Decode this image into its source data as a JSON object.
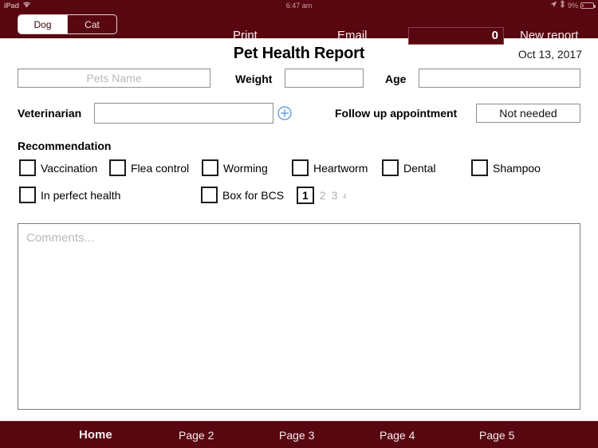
{
  "statusbar": {
    "device": "iPad",
    "wifi_icon": "wifi-icon",
    "time": "6:47 am",
    "location_icon": "location-arrow-icon",
    "bluetooth_icon": "bluetooth-icon",
    "battery_percent": "9%",
    "battery_level": 9
  },
  "toolbar": {
    "segments": [
      {
        "label": "Dog",
        "selected": true
      },
      {
        "label": "Cat",
        "selected": false
      }
    ],
    "print_label": "Print",
    "email_label": "Email",
    "counter_value": "0",
    "new_report_label": "New report"
  },
  "header": {
    "title": "Pet Health Report",
    "date": "Oct 13, 2017"
  },
  "form": {
    "pet_name": {
      "value": "",
      "placeholder": "Pets Name"
    },
    "weight": {
      "label": "Weight",
      "value": ""
    },
    "age": {
      "label": "Age",
      "value": ""
    },
    "veterinarian": {
      "label": "Veterinarian",
      "value": ""
    },
    "add_vet_icon": "circle-plus-icon",
    "follow_up": {
      "label": "Follow up appointment",
      "value": "Not needed"
    }
  },
  "recommendation": {
    "heading": "Recommendation",
    "checkboxes": [
      {
        "label": "Vaccination",
        "checked": false
      },
      {
        "label": "Flea control",
        "checked": false
      },
      {
        "label": "Worming",
        "checked": false
      },
      {
        "label": "Heartworm",
        "checked": false
      },
      {
        "label": "Dental",
        "checked": false
      },
      {
        "label": "Shampoo",
        "checked": false
      },
      {
        "label": "In perfect health",
        "checked": false
      },
      {
        "label": "Box for BCS",
        "checked": false
      }
    ],
    "bcs": {
      "options": [
        "1",
        "2",
        "3",
        "4"
      ],
      "selected": "1"
    }
  },
  "comments": {
    "value": "",
    "placeholder": "Comments..."
  },
  "bottomnav": {
    "items": [
      {
        "label": "Home",
        "active": true
      },
      {
        "label": "Page 2",
        "active": false
      },
      {
        "label": "Page 3",
        "active": false
      },
      {
        "label": "Page 4",
        "active": false
      },
      {
        "label": "Page 5",
        "active": false
      }
    ]
  },
  "colors": {
    "brand_maroon": "#58060f",
    "brand_maroon_dark": "#3d0409",
    "accent_blue": "#4a90e2",
    "placeholder_gray": "#b9b9b9",
    "field_border": "#8e8e8e",
    "battery_red": "#d9534f"
  }
}
